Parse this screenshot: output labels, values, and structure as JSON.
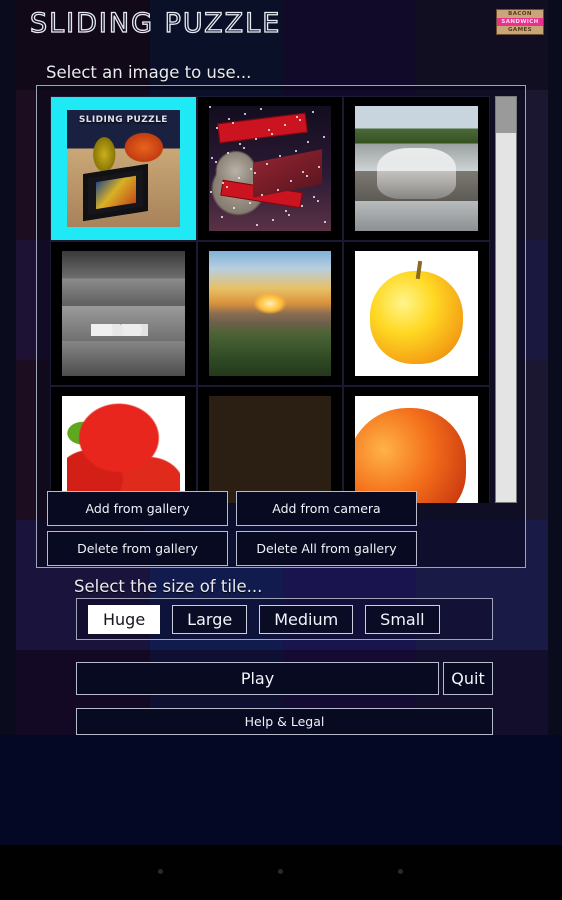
{
  "app": {
    "title": "SLIDING PUZZLE",
    "publisher": {
      "line1": "BACON",
      "line2": "SANDWICH",
      "line3": "GAMES"
    }
  },
  "sections": {
    "image_label": "Select an image to use...",
    "size_label": "Select the size of tile..."
  },
  "gallery": {
    "selected_index": 0,
    "selection_color": "#1ee9f5",
    "thumbnails": [
      {
        "name": "sliding-puzzle-cover",
        "caption": "SLIDING PUZZLE",
        "art": "t-puzzle",
        "selected": true
      },
      {
        "name": "christmas-snowplow",
        "caption": "",
        "art": "t-xmas",
        "selected": false
      },
      {
        "name": "waterfall-rocks",
        "caption": "",
        "art": "t-falls",
        "selected": false
      },
      {
        "name": "sheep-moorland-bw",
        "caption": "",
        "art": "t-sheep",
        "selected": false
      },
      {
        "name": "sunset-estuary",
        "caption": "",
        "art": "t-sunset",
        "selected": false
      },
      {
        "name": "yellow-apple",
        "caption": "",
        "art": "t-apple",
        "selected": false
      },
      {
        "name": "strawberries",
        "caption": "",
        "art": "t-straw",
        "selected": false
      },
      {
        "name": "mixed-nuts-raisins",
        "caption": "",
        "art": "t-nuts",
        "selected": false
      },
      {
        "name": "peach-nectarine",
        "caption": "",
        "art": "t-peach",
        "selected": false
      }
    ],
    "scrollbar": {
      "thumb_color": "#9a9a9a",
      "track_color": "#e4e4e4",
      "thumb_position_percent": 0
    },
    "buttons": [
      {
        "id": "add-from-gallery",
        "label": "Add from gallery"
      },
      {
        "id": "add-from-camera",
        "label": "Add from camera"
      },
      {
        "id": "delete-from-gallery",
        "label": "Delete from gallery"
      },
      {
        "id": "delete-all-from-gallery",
        "label": "Delete All from gallery"
      }
    ]
  },
  "tile_size": {
    "selected": "Huge",
    "options": [
      {
        "id": "huge",
        "label": "Huge",
        "active": true
      },
      {
        "id": "large",
        "label": "Large",
        "active": false
      },
      {
        "id": "medium",
        "label": "Medium",
        "active": false
      },
      {
        "id": "small",
        "label": "Small",
        "active": false
      }
    ]
  },
  "actions": {
    "play": "Play",
    "quit": "Quit",
    "help": "Help & Legal"
  },
  "theme": {
    "panel_border": "#9ea3b8",
    "button_bg": "#080a22",
    "button_border": "#b7bccc",
    "text": "#f2f3f8",
    "background_bands": [
      "#1a0c1e",
      "#101a3a",
      "#1c0f3c",
      "#1a1630"
    ]
  },
  "navbar": {
    "dots": 3
  }
}
